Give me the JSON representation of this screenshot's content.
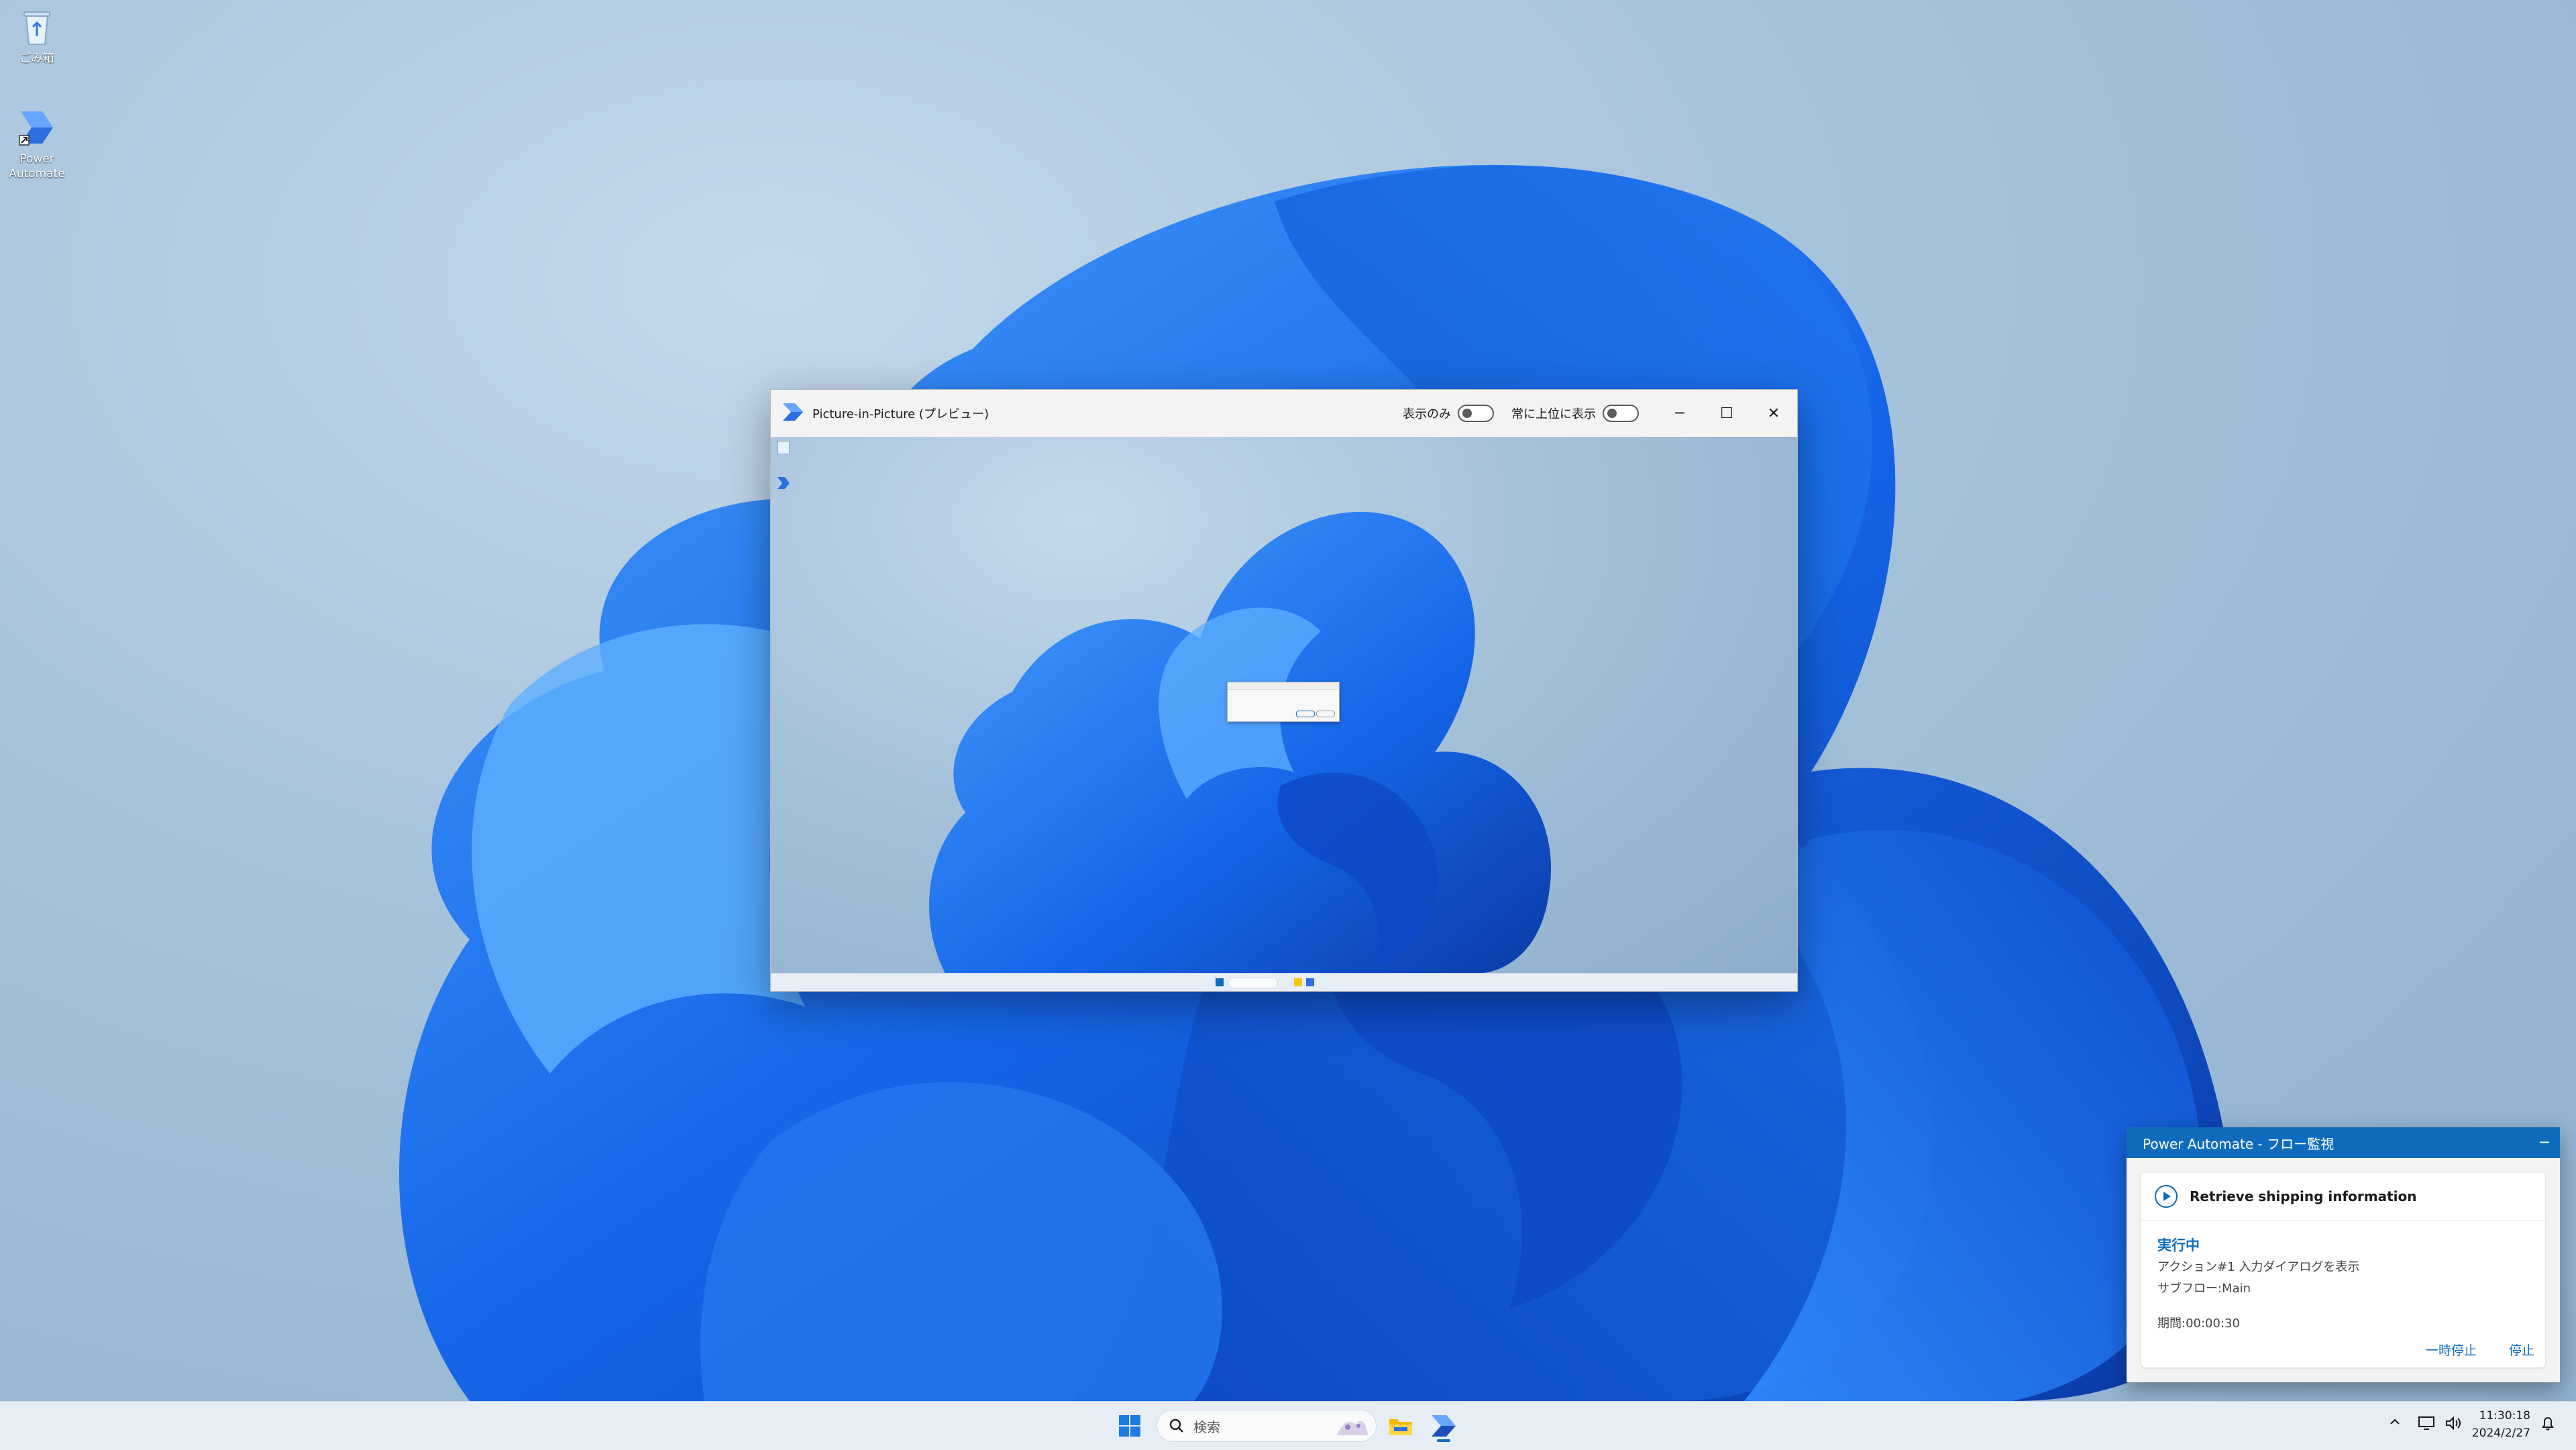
{
  "desktop": {
    "icons": [
      {
        "label": "ごみ箱",
        "icon": "recycle-bin-icon"
      },
      {
        "label": "Power Automate",
        "icon": "power-automate-icon"
      }
    ]
  },
  "pip_window": {
    "title": "Picture-in-Picture (プレビュー)",
    "toggle_view_only_label": "表示のみ",
    "toggle_view_only_on": false,
    "toggle_always_on_top_label": "常に上位に表示",
    "toggle_always_on_top_on": false,
    "minimize_glyph": "─",
    "maximize_glyph": "☐",
    "close_glyph": "✕"
  },
  "flow_monitor": {
    "header_title": "Power Automate - フロー監視",
    "minimize_glyph": "─",
    "flow_name": "Retrieve shipping information",
    "status": "実行中",
    "action_line": "アクション#1 入力ダイアログを表示",
    "subflow_line": "サブフロー:Main",
    "duration_line": "期間:00:00:30",
    "pause_label": "一時停止",
    "stop_label": "停止"
  },
  "taskbar": {
    "search_placeholder": "検索",
    "clock_time": "11:30:18",
    "clock_date": "2024/2/27",
    "tray_icons": [
      "chevron-up-icon",
      "network-icon",
      "volume-icon",
      "notification-bell-icon"
    ],
    "pinned": [
      "start-icon",
      "search-icon",
      "file-explorer-icon",
      "power-automate-icon"
    ]
  },
  "colors": {
    "accent": "#0f6cbd",
    "bloom_dark": "#0a3fb3",
    "bloom_light": "#3a8ff0"
  }
}
